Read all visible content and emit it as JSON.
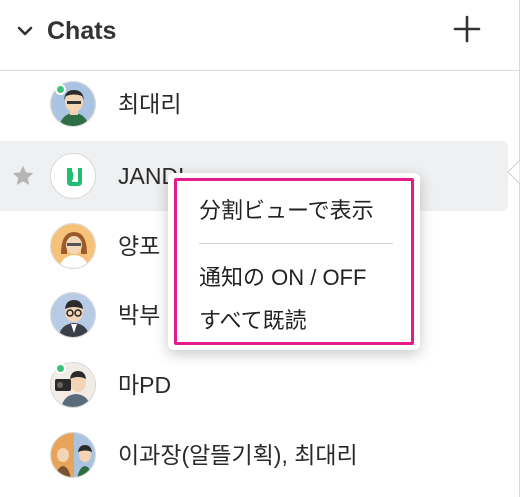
{
  "header": {
    "title": "Chats",
    "collapse_icon": "chevron-down-icon",
    "add_icon": "plus-icon"
  },
  "chats": [
    {
      "name": "최대리",
      "online": true,
      "starred": false,
      "avatar": "avatar-man-green-hair"
    },
    {
      "name": "JANDI",
      "online": false,
      "starred": true,
      "selected": true,
      "avatar": "jandi-logo"
    },
    {
      "name": "양포",
      "online": false,
      "starred": false,
      "avatar": "avatar-woman-orange"
    },
    {
      "name": "박부",
      "online": false,
      "starred": false,
      "avatar": "avatar-man-glasses-suit"
    },
    {
      "name": "마PD",
      "online": true,
      "starred": false,
      "avatar": "avatar-man-camera"
    },
    {
      "name": "이과장(알뜰기획), 최대리",
      "online": false,
      "starred": false,
      "avatar": "avatar-group"
    }
  ],
  "context_menu": {
    "items": [
      "分割ビューで表示",
      "通知の ON / OFF",
      "すべて既読"
    ]
  },
  "colors": {
    "online": "#3cc07a",
    "highlight_border": "#e6198d",
    "selected_row": "#eef0f1",
    "jandi_green": "#1fbe74"
  }
}
